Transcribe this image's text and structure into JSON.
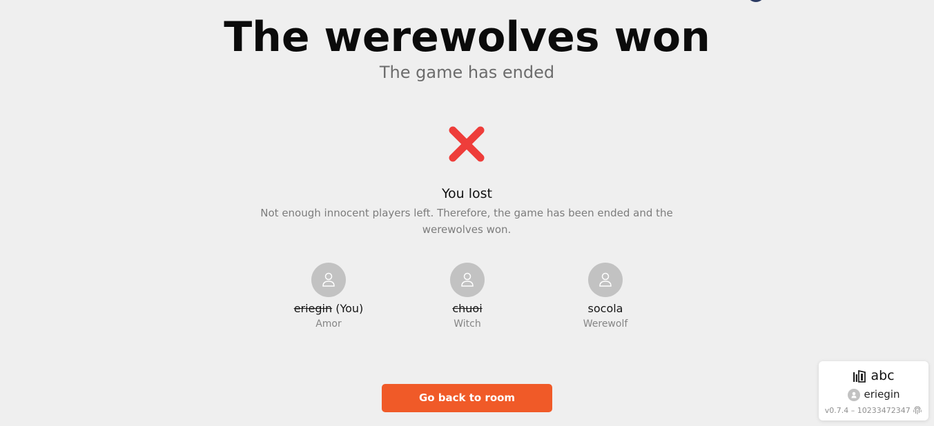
{
  "header": {
    "title": "The werewolves won",
    "subtitle": "The game has ended"
  },
  "result": {
    "icon": "red-x-icon",
    "title": "You lost",
    "description": "Not enough innocent players left. Therefore, the game has been ended and the werewolves won."
  },
  "players": [
    {
      "name": "eriegin",
      "suffix": " (You)",
      "role": "Amor",
      "dead": true
    },
    {
      "name": "chuoi",
      "suffix": "",
      "role": "Witch",
      "dead": true
    },
    {
      "name": "socola",
      "suffix": "",
      "role": "Werewolf",
      "dead": false
    }
  ],
  "actions": {
    "back_label": "Go back to room"
  },
  "room_card": {
    "room_icon": "door-icon",
    "room_name": "abc",
    "user_name": "eriegin",
    "version": "v0.7.4 – 10233472347",
    "version_icon": "fingerprint-icon"
  },
  "colors": {
    "accent": "#f05a28",
    "lost_icon": "#ee3d3a",
    "background": "#efefef"
  }
}
